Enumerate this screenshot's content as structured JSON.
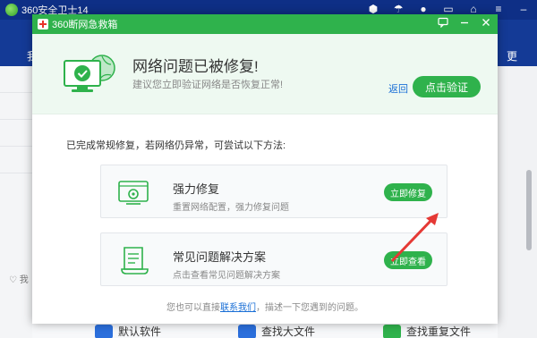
{
  "bg": {
    "app_title": "360安全卫士14",
    "nav_frag_left": "我",
    "nav_frag_right": "更",
    "like_label": "我",
    "bottom_items": [
      {
        "label": "默认软件",
        "color": "#2b6fdc"
      },
      {
        "label": "查找大文件",
        "color": "#2b6fdc"
      },
      {
        "label": "查找重复文件",
        "color": "#2fb24c"
      }
    ]
  },
  "dialog": {
    "title": "360断网急救箱",
    "header": {
      "title": "网络问题已被修复!",
      "subtitle": "建议您立即验证网络是否恢复正常!",
      "back_label": "返回",
      "verify_label": "点击验证"
    },
    "tips": "已完成常规修复，若网络仍异常，可尝试以下方法:",
    "cards": [
      {
        "title": "强力修复",
        "desc": "重置网络配置，强力修复问题",
        "button": "立即修复",
        "icon": "computer-repair-icon"
      },
      {
        "title": "常见问题解决方案",
        "desc": "点击查看常见问题解决方案",
        "button": "立即查看",
        "icon": "document-scroll-icon"
      }
    ],
    "footer": {
      "prefix": "您也可以直接",
      "link": "联系我们",
      "suffix": "，描述一下您遇到的问题。"
    }
  },
  "colors": {
    "accent": "#2fb24c",
    "link": "#1a6fd6",
    "arrow": "#e53935",
    "bg_nav": "#143a96"
  }
}
